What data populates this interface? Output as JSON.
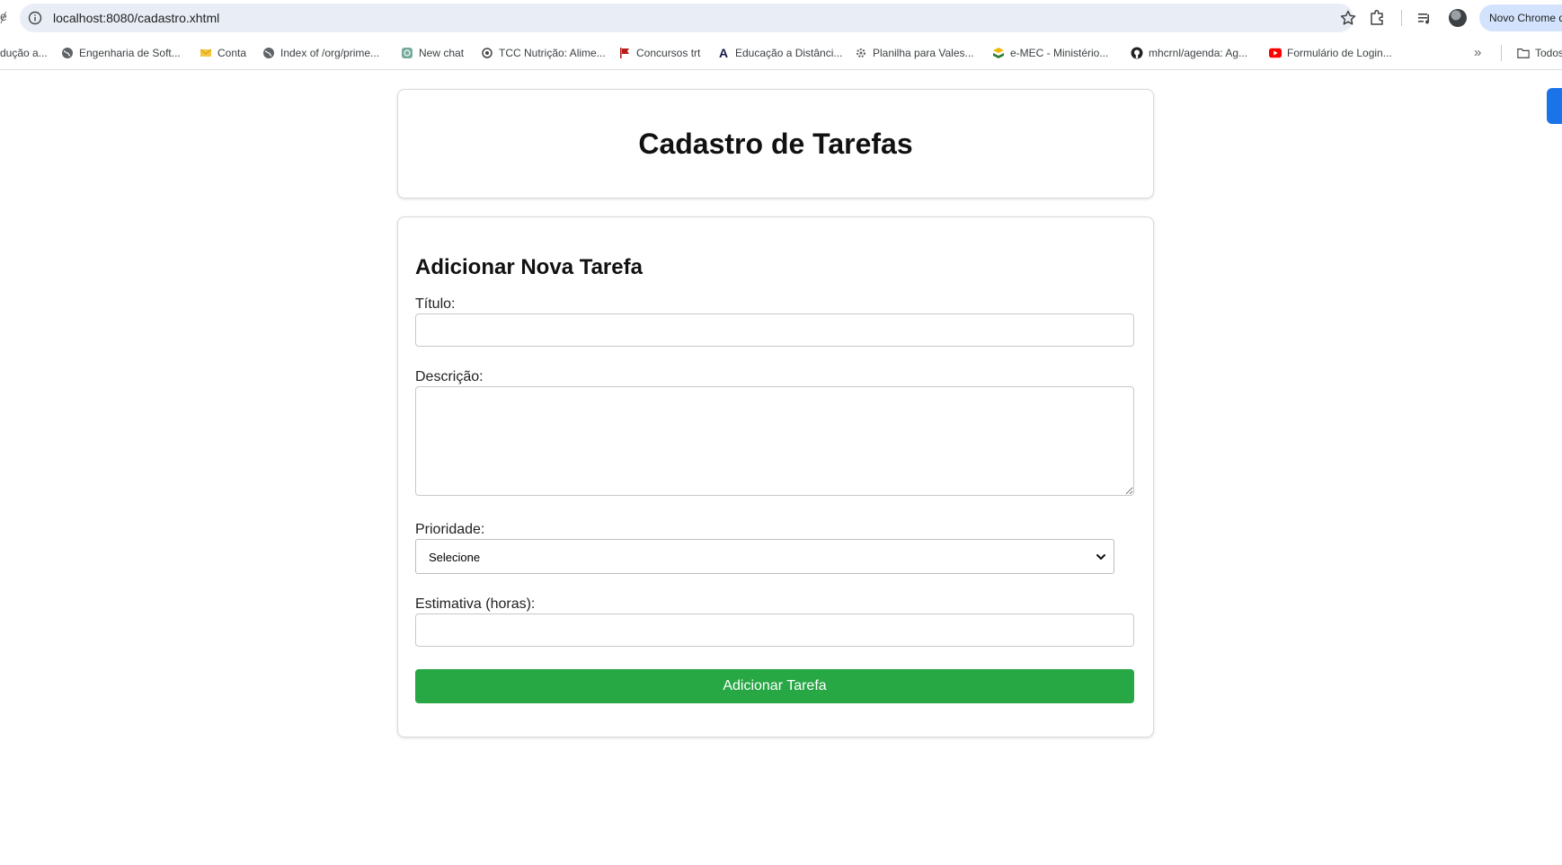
{
  "browser": {
    "left_glyph": "ɇ",
    "url": "localhost:8080/cadastro.xhtml",
    "profile_label": "Novo Chrome disponível",
    "bookmarks": [
      {
        "label": "dução a...",
        "icon": "none"
      },
      {
        "label": "Engenharia de Soft...",
        "icon": "globe-icon"
      },
      {
        "label": "Conta",
        "icon": "envelope-icon"
      },
      {
        "label": "Index of /org/prime...",
        "icon": "globe-icon"
      },
      {
        "label": "New chat",
        "icon": "chat-icon"
      },
      {
        "label": "TCC Nutrição: Alime...",
        "icon": "openai-icon"
      },
      {
        "label": "Concursos trt",
        "icon": "flag-icon"
      },
      {
        "label": "Educação a Distânci...",
        "icon": "letter-a-icon"
      },
      {
        "label": "Planilha para Vales...",
        "icon": "gear-icon"
      },
      {
        "label": "e-MEC - Ministério...",
        "icon": "mec-icon"
      },
      {
        "label": "mhcrnl/agenda: Ag...",
        "icon": "github-icon"
      },
      {
        "label": "Formulário de Login...",
        "icon": "youtube-icon"
      }
    ],
    "more_glyph": "»",
    "all_bookmarks_label": "Todos os favoritos"
  },
  "page": {
    "title": "Cadastro de Tarefas",
    "form": {
      "heading": "Adicionar Nova Tarefa",
      "titulo_label": "Título:",
      "titulo_value": "",
      "descricao_label": "Descrição:",
      "descricao_value": "",
      "prioridade_label": "Prioridade:",
      "prioridade_selected": "Selecione",
      "estimativa_label": "Estimativa (horas):",
      "estimativa_value": "",
      "submit_label": "Adicionar Tarefa"
    }
  },
  "colors": {
    "submit_button": "#28a745",
    "omnibox": "#e9eef6",
    "profile_pill": "#d3e3fd"
  }
}
